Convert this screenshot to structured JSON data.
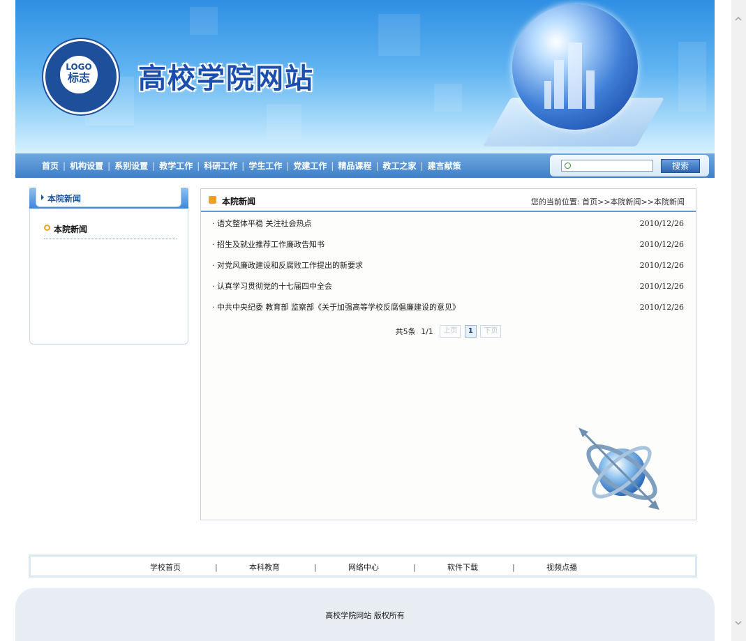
{
  "header": {
    "logo_top": "LOGO",
    "logo_bottom": "标志",
    "site_title": "高校学院网站"
  },
  "nav": {
    "items": [
      "首页",
      "机构设置",
      "系别设置",
      "教学工作",
      "科研工作",
      "学生工作",
      "党建工作",
      "精品课程",
      "教工之家",
      "建言献策"
    ],
    "separator": "|",
    "search_placeholder": "",
    "search_button": "搜索"
  },
  "sidebar": {
    "header": "本院新闻",
    "items": [
      "本院新闻"
    ]
  },
  "main": {
    "title": "本院新闻",
    "location": "您的当前位置:   首页>>本院新闻>>本院新闻",
    "news": [
      {
        "title": "· 语文整体平稳 关注社会热点",
        "date": "2010/12/26"
      },
      {
        "title": "· 招生及就业推荐工作廉政告知书",
        "date": "2010/12/26"
      },
      {
        "title": "· 对党风廉政建设和反腐败工作提出的新要求",
        "date": "2010/12/26"
      },
      {
        "title": "· 认真学习贯彻党的十七届四中全会",
        "date": "2010/12/26"
      },
      {
        "title": "· 中共中央纪委 教育部 监察部《关于加强高等学校反腐倡廉建设的意见》",
        "date": "2010/12/26"
      }
    ],
    "pager": {
      "total": "共5条",
      "pages": "1/1",
      "prev": "上页",
      "current": "1",
      "next": "下页"
    }
  },
  "footer": {
    "links": [
      "学校首页",
      "本科教育",
      "网络中心",
      "软件下载",
      "视频点播"
    ],
    "separator": "|",
    "copyright": "高校学院网站   版权所有"
  },
  "colors": {
    "nav_bg": "#3f7fc8",
    "accent": "#f0a020",
    "title_blue": "#1a4fb0"
  }
}
